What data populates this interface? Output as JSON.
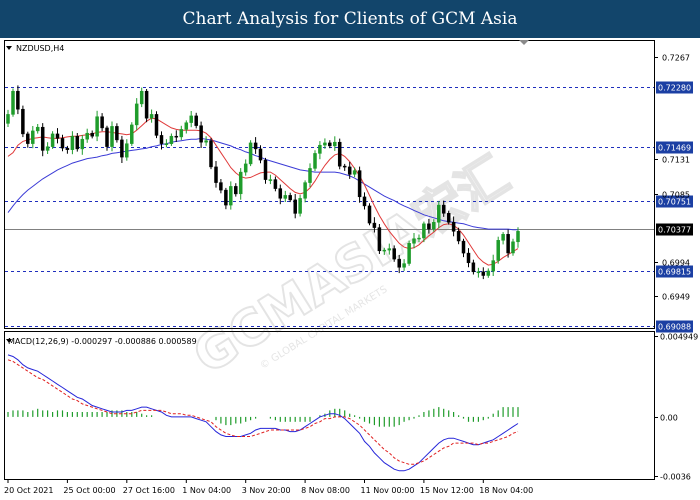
{
  "banner": {
    "title": "Chart Analysis for Clients of GCM Asia"
  },
  "watermark": {
    "main": "GCMASIA宏汇",
    "sub": "© GLOBAL CAPITAL MARKETS"
  },
  "colors": {
    "banner_bg": "#12456b",
    "bull": "#1f9c2b",
    "bear": "#000000",
    "ma_fast": "#e03a3a",
    "ma_slow": "#3b3bd6",
    "level_line": "#1f2fbd",
    "level_label_bg": "#1b3fa3",
    "price_label_bg": "#000000",
    "macd_hist": "#1f9c2b",
    "macd_main": "#2626d9",
    "macd_signal": "#e02020"
  },
  "chart_data": [
    {
      "type": "candlestick",
      "title": "NZDUSD,H4",
      "symbol": "NZDUSD",
      "timeframe": "H4",
      "ylim": [
        0.6906,
        0.7289
      ],
      "y_ticks": [
        0.7267,
        0.7131,
        0.7085,
        0.6994,
        0.6949
      ],
      "x_ticks": [
        "20 Oct 2021",
        "25 Oct 00:00",
        "27 Oct 16:00",
        "1 Nov 04:00",
        "3 Nov 20:00",
        "8 Nov 08:00",
        "11 Nov 00:00",
        "15 Nov 12:00",
        "18 Nov 04:00"
      ],
      "current_price": 0.70377,
      "levels": [
        0.7228,
        0.71469,
        0.70751,
        0.69815,
        0.69088
      ],
      "series": [
        {
          "name": "close",
          "values": [
            0.7191,
            0.7222,
            0.7198,
            0.7165,
            0.7152,
            0.7169,
            0.7174,
            0.7143,
            0.7148,
            0.7165,
            0.7159,
            0.7146,
            0.7144,
            0.7162,
            0.7145,
            0.7158,
            0.7166,
            0.7162,
            0.7188,
            0.7173,
            0.7148,
            0.7175,
            0.7157,
            0.7134,
            0.7152,
            0.7177,
            0.7205,
            0.7222,
            0.7186,
            0.7191,
            0.7163,
            0.7152,
            0.7152,
            0.7162,
            0.7161,
            0.7171,
            0.718,
            0.7189,
            0.7176,
            0.7154,
            0.7156,
            0.7121,
            0.71,
            0.709,
            0.707,
            0.7095,
            0.7085,
            0.7114,
            0.7125,
            0.7153,
            0.7145,
            0.713,
            0.7104,
            0.7104,
            0.7092,
            0.7079,
            0.7083,
            0.7077,
            0.7059,
            0.7079,
            0.71,
            0.7119,
            0.7139,
            0.715,
            0.7153,
            0.7149,
            0.7154,
            0.7122,
            0.7121,
            0.7111,
            0.7116,
            0.7081,
            0.7069,
            0.7046,
            0.704,
            0.7009,
            0.701,
            0.7012,
            0.6998,
            0.6987,
            0.6992,
            0.7019,
            0.7025,
            0.7026,
            0.7045,
            0.7038,
            0.7047,
            0.707,
            0.7059,
            0.7047,
            0.7035,
            0.7022,
            0.7006,
            0.6993,
            0.6981,
            0.6981,
            0.6976,
            0.6982,
            0.6996,
            0.7023,
            0.7031,
            0.7006,
            0.7021,
            0.7035
          ]
        },
        {
          "name": "MA fast",
          "values": [
            0.7135,
            0.714,
            0.715,
            0.7155,
            0.7157,
            0.7159,
            0.716,
            0.7161,
            0.716,
            0.7159,
            0.7159,
            0.716,
            0.7161,
            0.7162,
            0.7162,
            0.7163,
            0.7164,
            0.7165,
            0.7167,
            0.7168,
            0.7168,
            0.7167,
            0.7166,
            0.7165,
            0.7164,
            0.7165,
            0.717,
            0.7176,
            0.7182,
            0.7186,
            0.7185,
            0.7181,
            0.7177,
            0.7173,
            0.7171,
            0.717,
            0.717,
            0.717,
            0.717,
            0.7169,
            0.7166,
            0.716,
            0.715,
            0.714,
            0.713,
            0.712,
            0.7113,
            0.7108,
            0.7106,
            0.7107,
            0.711,
            0.7113,
            0.7114,
            0.7114,
            0.711,
            0.7104,
            0.7098,
            0.7092,
            0.7087,
            0.7085,
            0.7087,
            0.7093,
            0.7102,
            0.7113,
            0.7123,
            0.7131,
            0.7137,
            0.7139,
            0.7135,
            0.7128,
            0.7119,
            0.7109,
            0.7097,
            0.7083,
            0.7069,
            0.7056,
            0.7045,
            0.7035,
            0.7027,
            0.7019,
            0.7014,
            0.7012,
            0.7013,
            0.7017,
            0.7023,
            0.7029,
            0.7034,
            0.704,
            0.7044,
            0.7045,
            0.7043,
            0.7038,
            0.703,
            0.702,
            0.701,
            0.7,
            0.6994,
            0.699,
            0.6991,
            0.6995,
            0.7,
            0.7004,
            0.7008,
            0.7012
          ]
        },
        {
          "name": "MA slow",
          "values": [
            0.706,
            0.7069,
            0.7077,
            0.7084,
            0.709,
            0.7095,
            0.71,
            0.7105,
            0.7109,
            0.7113,
            0.7117,
            0.712,
            0.7123,
            0.7126,
            0.7128,
            0.713,
            0.7132,
            0.7133,
            0.7134,
            0.7136,
            0.7137,
            0.7139,
            0.714,
            0.7141,
            0.7142,
            0.7143,
            0.7144,
            0.7145,
            0.7146,
            0.7148,
            0.7149,
            0.7151,
            0.7152,
            0.7154,
            0.7155,
            0.7156,
            0.7157,
            0.7158,
            0.7158,
            0.7159,
            0.7158,
            0.7157,
            0.7155,
            0.7153,
            0.7151,
            0.7149,
            0.7146,
            0.7144,
            0.7141,
            0.7139,
            0.7136,
            0.7134,
            0.7131,
            0.7129,
            0.7127,
            0.7125,
            0.7123,
            0.7121,
            0.7119,
            0.7117,
            0.7116,
            0.7115,
            0.7114,
            0.7114,
            0.7114,
            0.7114,
            0.7114,
            0.7113,
            0.7111,
            0.7109,
            0.7106,
            0.7102,
            0.7098,
            0.7094,
            0.709,
            0.7086,
            0.7082,
            0.7079,
            0.7076,
            0.7072,
            0.7069,
            0.7066,
            0.7063,
            0.706,
            0.7057,
            0.7055,
            0.7053,
            0.7051,
            0.7049,
            0.7048,
            0.7047,
            0.7046,
            0.7045,
            0.7043,
            0.7041,
            0.704,
            0.7039,
            0.7038,
            0.7038,
            0.7038,
            0.7038,
            0.7038,
            0.7037,
            0.7037
          ]
        }
      ]
    },
    {
      "type": "macd",
      "title": "MACD(12,26,9) -0.000297 -0.000886 0.000589",
      "ylim": [
        -0.0038,
        0.0052
      ],
      "y_ticks": [
        "0.004949",
        "0.00",
        "-0.0036"
      ],
      "series": [
        {
          "name": "histogram",
          "values": [
            0.0003,
            0.0004,
            0.0004,
            0.0004,
            0.0003,
            0.0004,
            0.0005,
            0.0004,
            0.0004,
            0.0003,
            0.0004,
            0.0004,
            0.0003,
            0.0003,
            0.0003,
            0.0003,
            0.0003,
            0.0003,
            0.0003,
            0.0003,
            0.0003,
            0.0004,
            0.0004,
            0.0004,
            0.0003,
            0.0003,
            0.0003,
            0.0002,
            0.0001,
            0.0001,
            0.0,
            0.0,
            0.0,
            0.0,
            0.0,
            0.0,
            0.0,
            0.0,
            0.0,
            0.0,
            0.0,
            0.0,
            -0.0002,
            -0.0004,
            -0.0005,
            -0.0005,
            -0.0004,
            -0.0004,
            -0.0003,
            -0.0002,
            -0.0001,
            0.0,
            0.0,
            -0.0001,
            -0.0002,
            -0.0003,
            -0.0003,
            -0.0003,
            -0.0003,
            -0.0003,
            -0.0003,
            -0.0003,
            0.0,
            0.0001,
            0.0002,
            0.0004,
            0.0005,
            0.0005,
            0.0004,
            0.0002,
            0.0001,
            -0.0001,
            -0.0003,
            -0.0004,
            -0.0005,
            -0.0006,
            -0.0006,
            -0.0006,
            -0.0006,
            -0.0005,
            -0.0003,
            -0.0002,
            -0.0001,
            0.0001,
            0.0003,
            0.0004,
            0.0005,
            0.0006,
            0.0005,
            0.0004,
            0.0003,
            0.0001,
            -0.0001,
            -0.0003,
            -0.0003,
            -0.0003,
            -0.0002,
            -0.0001,
            0.0002,
            0.0004,
            0.0006,
            0.0006,
            0.0006,
            0.0006
          ]
        },
        {
          "name": "MACD",
          "values": [
            0.0038,
            0.0037,
            0.0035,
            0.0032,
            0.003,
            0.0029,
            0.0028,
            0.0026,
            0.0024,
            0.0022,
            0.002,
            0.0018,
            0.0016,
            0.0014,
            0.0012,
            0.0011,
            0.0009,
            0.0007,
            0.0006,
            0.0005,
            0.0004,
            0.0003,
            0.0003,
            0.0003,
            0.0004,
            0.0004,
            0.0005,
            0.0006,
            0.0006,
            0.0005,
            0.0004,
            0.0003,
            0.0001,
            0.0,
            0.0,
            0.0,
            0.0,
            0.0,
            -0.0001,
            -0.0002,
            -0.0003,
            -0.0006,
            -0.0009,
            -0.0011,
            -0.0012,
            -0.0012,
            -0.0012,
            -0.0012,
            -0.0011,
            -0.001,
            -0.0008,
            -0.0007,
            -0.0007,
            -0.0007,
            -0.0007,
            -0.0008,
            -0.0008,
            -0.0009,
            -0.0009,
            -0.0008,
            -0.0006,
            -0.0004,
            -0.0002,
            0.0,
            0.0001,
            0.0002,
            0.0002,
            0.0001,
            -0.0001,
            -0.0004,
            -0.0007,
            -0.001,
            -0.0015,
            -0.0018,
            -0.0022,
            -0.0025,
            -0.0028,
            -0.003,
            -0.0032,
            -0.0033,
            -0.0033,
            -0.0032,
            -0.003,
            -0.0028,
            -0.0025,
            -0.0022,
            -0.0019,
            -0.0016,
            -0.0014,
            -0.0013,
            -0.0013,
            -0.0014,
            -0.0015,
            -0.0016,
            -0.0017,
            -0.0017,
            -0.0016,
            -0.0015,
            -0.0014,
            -0.0012,
            -0.001,
            -0.0008,
            -0.0006,
            -0.0004
          ]
        },
        {
          "name": "Signal",
          "values": [
            0.0035,
            0.0034,
            0.0032,
            0.003,
            0.0028,
            0.0026,
            0.0024,
            0.0023,
            0.0021,
            0.0019,
            0.0017,
            0.0015,
            0.0013,
            0.0011,
            0.001,
            0.0008,
            0.0007,
            0.0006,
            0.0005,
            0.0004,
            0.0003,
            0.0002,
            0.0002,
            0.0002,
            0.0002,
            0.0002,
            0.0003,
            0.0004,
            0.0004,
            0.0004,
            0.0004,
            0.0004,
            0.0003,
            0.0002,
            0.0002,
            0.0002,
            0.0001,
            0.0001,
            0.0,
            -0.0001,
            -0.0002,
            -0.0003,
            -0.0006,
            -0.0008,
            -0.001,
            -0.0011,
            -0.0012,
            -0.0012,
            -0.0012,
            -0.0012,
            -0.0011,
            -0.001,
            -0.0009,
            -0.0008,
            -0.0008,
            -0.0008,
            -0.0008,
            -0.0008,
            -0.0008,
            -0.0008,
            -0.0007,
            -0.0006,
            -0.0004,
            -0.0003,
            -0.0001,
            -0.0001,
            0.0,
            0.0,
            0.0,
            -0.0001,
            -0.0003,
            -0.0005,
            -0.0008,
            -0.0011,
            -0.0014,
            -0.0017,
            -0.002,
            -0.0022,
            -0.0025,
            -0.0027,
            -0.0028,
            -0.0029,
            -0.0029,
            -0.0028,
            -0.0027,
            -0.0025,
            -0.0023,
            -0.0021,
            -0.0019,
            -0.0018,
            -0.0016,
            -0.0016,
            -0.0016,
            -0.0016,
            -0.0016,
            -0.0017,
            -0.0016,
            -0.0016,
            -0.0015,
            -0.0014,
            -0.0013,
            -0.0012,
            -0.001,
            -0.0009
          ]
        }
      ]
    }
  ]
}
